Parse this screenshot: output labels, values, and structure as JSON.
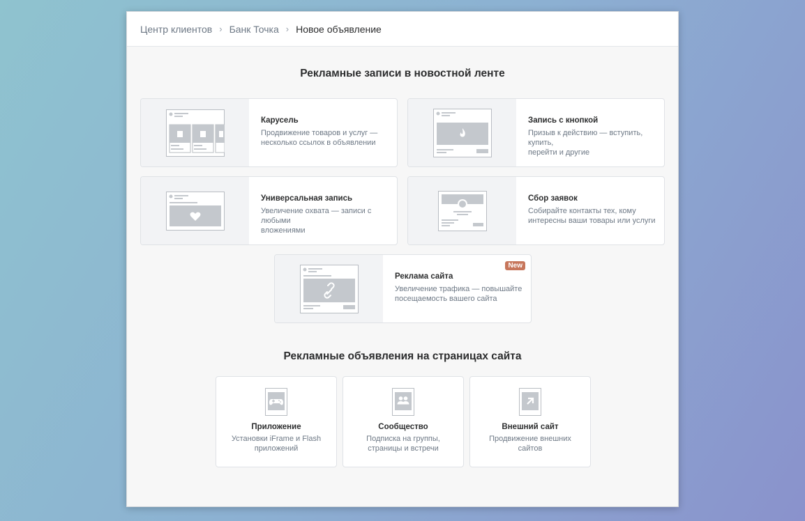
{
  "breadcrumb": [
    "Центр клиентов",
    "Банк Точка",
    "Новое объявление"
  ],
  "sections": {
    "feed_title": "Рекламные записи в новостной ленте",
    "site_title": "Рекламные объявления на страницах сайта"
  },
  "feed_cards": [
    {
      "title": "Карусель",
      "desc": "Продвижение товаров и услуг —\nнесколько ссылок в объявлении",
      "icon": "carousel-preview-icon"
    },
    {
      "title": "Запись с кнопкой",
      "desc": "Призыв к действию — вступить, купить,\nперейти и другие",
      "icon": "button-post-preview-icon"
    },
    {
      "title": "Универсальная запись",
      "desc": "Увеличение охвата — записи с любыми\nвложениями",
      "icon": "universal-post-preview-icon"
    },
    {
      "title": "Сбор заявок",
      "desc": "Собирайте контакты тех, кому\nинтересны ваши товары или услуги",
      "icon": "lead-form-preview-icon"
    },
    {
      "title": "Реклама сайта",
      "desc": "Увеличение трафика — повышайте\nпосещаемость вашего сайта",
      "icon": "site-ad-preview-icon",
      "badge": "New"
    }
  ],
  "site_cards": [
    {
      "title": "Приложение",
      "desc": "Установки iFrame и Flash\nприложений",
      "icon": "gamepad-icon"
    },
    {
      "title": "Сообщество",
      "desc": "Подписка на группы,\nстраницы и встречи",
      "icon": "users-icon"
    },
    {
      "title": "Внешний сайт",
      "desc": "Продвижение внешних\nсайтов",
      "icon": "external-link-icon"
    }
  ],
  "colors": {
    "badge": "#c7765b",
    "muted_text": "#6d7885",
    "title_text": "#2c2d2e"
  }
}
